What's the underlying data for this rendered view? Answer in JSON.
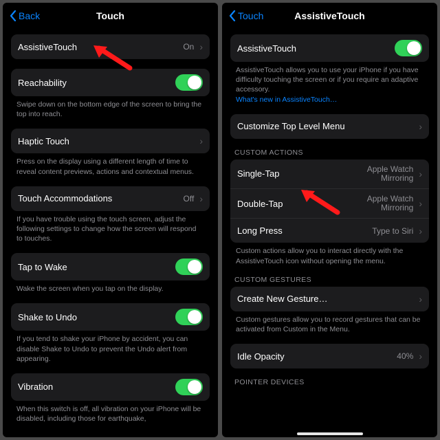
{
  "left": {
    "back": "Back",
    "title": "Touch",
    "rows": {
      "assistive": {
        "label": "AssistiveTouch",
        "value": "On"
      },
      "reachability": {
        "label": "Reachability"
      },
      "reachability_footer": "Swipe down on the bottom edge of the screen to bring the top into reach.",
      "haptic": {
        "label": "Haptic Touch"
      },
      "haptic_footer": "Press on the display using a different length of time to reveal content previews, actions and contextual menus.",
      "accommodations": {
        "label": "Touch Accommodations",
        "value": "Off"
      },
      "accommodations_footer": "If you have trouble using the touch screen, adjust the following settings to change how the screen will respond to touches.",
      "tap_to_wake": {
        "label": "Tap to Wake"
      },
      "tap_to_wake_footer": "Wake the screen when you tap on the display.",
      "shake": {
        "label": "Shake to Undo"
      },
      "shake_footer": "If you tend to shake your iPhone by accident, you can disable Shake to Undo to prevent the Undo alert from appearing.",
      "vibration": {
        "label": "Vibration"
      },
      "vibration_footer": "When this switch is off, all vibration on your iPhone will be disabled, including those for earthquake,"
    }
  },
  "right": {
    "back": "Touch",
    "title": "AssistiveTouch",
    "rows": {
      "assistive": {
        "label": "AssistiveTouch"
      },
      "assistive_footer": "AssistiveTouch allows you to use your iPhone if you have difficulty touching the screen or if you require an adaptive accessory.",
      "whatsnew": "What's new in AssistiveTouch…",
      "customize": {
        "label": "Customize Top Level Menu"
      },
      "custom_actions_header": "CUSTOM ACTIONS",
      "single_tap": {
        "label": "Single-Tap",
        "value": "Apple Watch\nMirroring"
      },
      "double_tap": {
        "label": "Double-Tap",
        "value": "Apple Watch\nMirroring"
      },
      "long_press": {
        "label": "Long Press",
        "value": "Type to Siri"
      },
      "actions_footer": "Custom actions allow you to interact directly with the AssistiveTouch icon without opening the menu.",
      "custom_gestures_header": "CUSTOM GESTURES",
      "create_gesture": {
        "label": "Create New Gesture…"
      },
      "gestures_footer": "Custom gestures allow you to record gestures that can be activated from Custom in the Menu.",
      "idle_opacity": {
        "label": "Idle Opacity",
        "value": "40%"
      },
      "pointer_header": "POINTER DEVICES"
    }
  }
}
